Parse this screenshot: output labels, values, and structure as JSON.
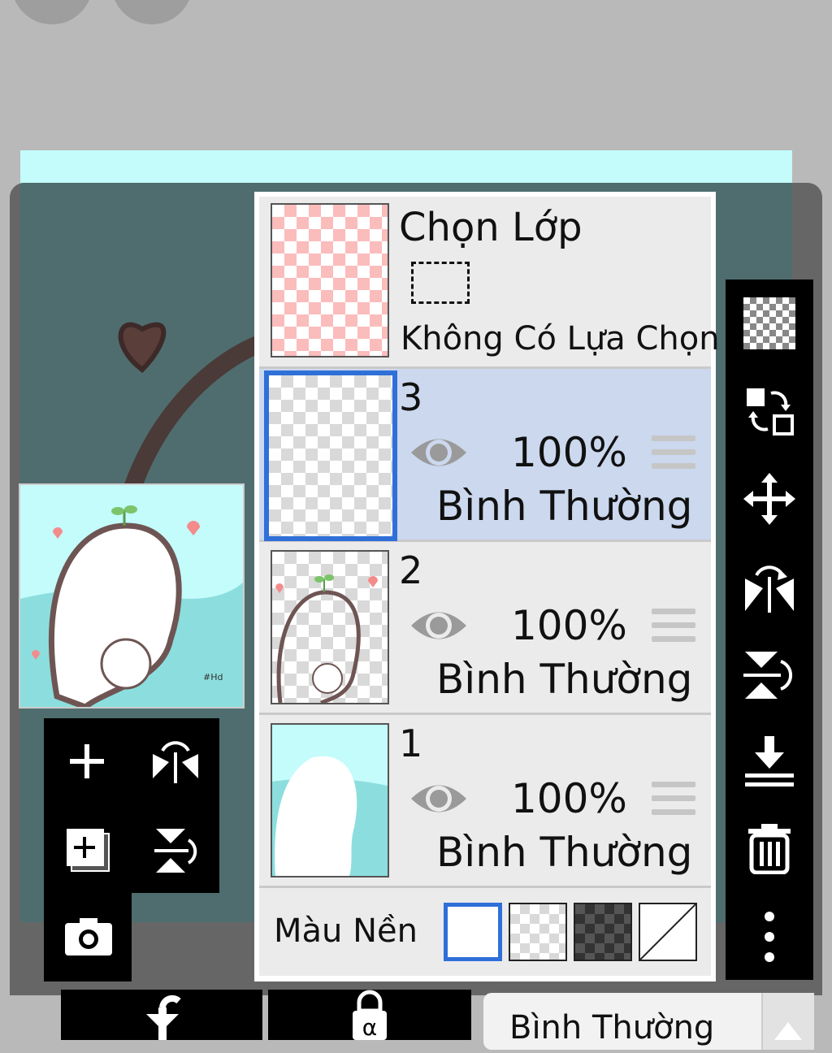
{
  "select_layer": {
    "title": "Chọn Lớp",
    "no_selection": "Không Có Lựa Chọn"
  },
  "layers": [
    {
      "number": "3",
      "opacity": "100%",
      "blend": "Bình Thường",
      "selected": true
    },
    {
      "number": "2",
      "opacity": "100%",
      "blend": "Bình Thường",
      "selected": false
    },
    {
      "number": "1",
      "opacity": "100%",
      "blend": "Bình Thường",
      "selected": false
    }
  ],
  "background": {
    "label": "Màu Nền",
    "options": [
      "white",
      "transparent-light",
      "transparent-dark",
      "none"
    ],
    "selected": "white"
  },
  "right_toolbar": [
    "checkerboard-icon",
    "swap-layers-icon",
    "move-icon",
    "flip-horizontal-icon",
    "flip-vertical-icon",
    "merge-down-icon",
    "trash-icon",
    "more-vertical-icon"
  ],
  "left_toolbar": [
    "add-layer-icon",
    "flip-horizontal-icon",
    "add-layer-copy-icon",
    "flip-vertical-icon",
    "camera-icon"
  ],
  "bottom": {
    "blend_mode": "Bình Thường"
  },
  "colors": {
    "accent": "#2f6fd8",
    "selected_row": "#cbd8ee",
    "canvas_bg": "#4f6d6e",
    "sky": "#c4fbfb"
  }
}
